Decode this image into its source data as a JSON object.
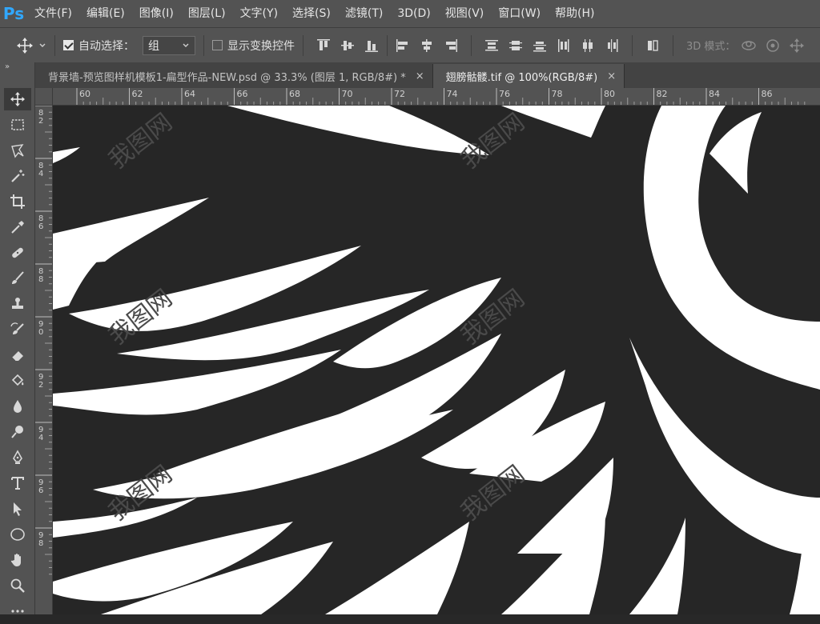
{
  "app": {
    "logo": "Ps",
    "accent_color": "#31a8ff"
  },
  "menu": {
    "items": [
      "文件(F)",
      "编辑(E)",
      "图像(I)",
      "图层(L)",
      "文字(Y)",
      "选择(S)",
      "滤镜(T)",
      "3D(D)",
      "视图(V)",
      "窗口(W)",
      "帮助(H)"
    ]
  },
  "options": {
    "auto_select_label": "自动选择：",
    "auto_select_checked": true,
    "auto_select_target": "组",
    "show_transform_label": "显示变换控件",
    "show_transform_checked": false,
    "mode_3d_label": "3D 模式："
  },
  "tabs": [
    {
      "title": "背景墙-预览图样机模板1-扁型作品-NEW.psd @ 33.3% (图层 1, RGB/8#) *",
      "close": "×",
      "active": false
    },
    {
      "title": "翅膀骷髅.tif @ 100%(RGB/8#)",
      "close": "×",
      "active": true
    }
  ],
  "ruler": {
    "top_labels": [
      "60",
      "62",
      "64",
      "66",
      "68",
      "70",
      "72",
      "74",
      "76",
      "78",
      "80",
      "82",
      "84",
      "86"
    ],
    "left_labels": [
      "82",
      "84",
      "86",
      "88",
      "90",
      "92",
      "94",
      "96",
      "98"
    ]
  },
  "tools": [
    "move-tool-icon",
    "marquee-tool-icon",
    "lasso-tool-icon",
    "magic-wand-icon",
    "crop-tool-icon",
    "eyedropper-icon",
    "healing-brush-icon",
    "brush-tool-icon",
    "clone-stamp-icon",
    "history-brush-icon",
    "eraser-icon",
    "paint-bucket-icon",
    "blur-tool-icon",
    "dodge-tool-icon",
    "pen-tool-icon",
    "type-tool-icon",
    "path-selection-icon",
    "ellipse-tool-icon",
    "hand-tool-icon",
    "zoom-tool-icon",
    "more-tools-icon"
  ],
  "watermark": {
    "text": "我图网"
  },
  "colors": {
    "canvas_bg": "#262626",
    "artwork": "#ffffff",
    "panel": "#535353"
  }
}
